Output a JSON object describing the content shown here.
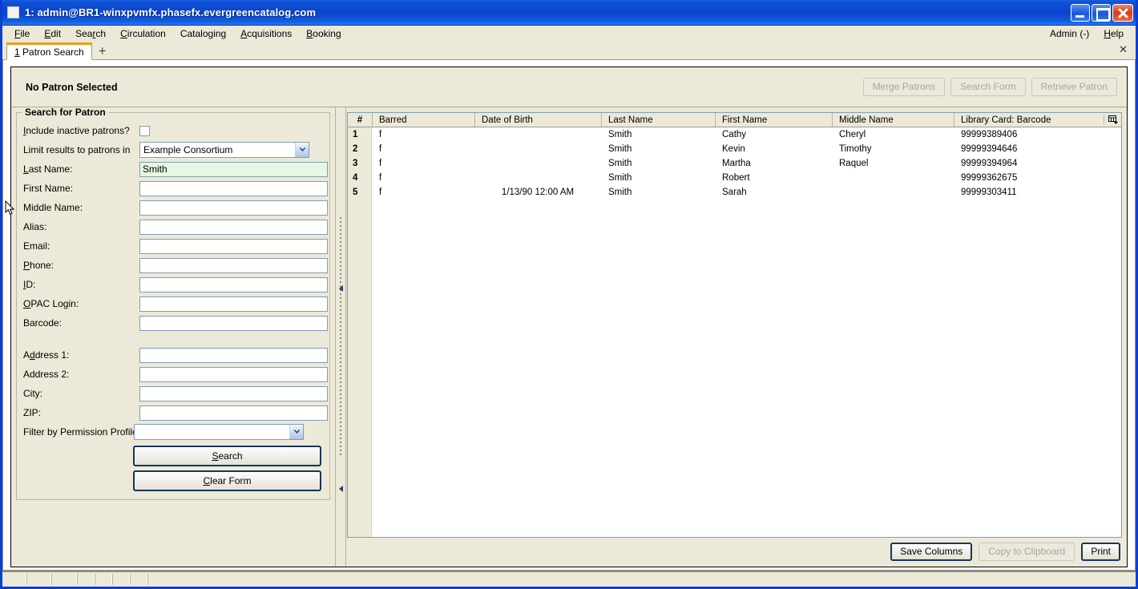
{
  "window": {
    "title": "1: admin@BR1-winxpvmfx.phasefx.evergreencatalog.com",
    "icon": "app-icon",
    "minimize_label": "_",
    "maximize_label": "□",
    "close_label": "✕"
  },
  "menubar": {
    "items": [
      {
        "label": "File",
        "accel": "F"
      },
      {
        "label": "Edit",
        "accel": "E"
      },
      {
        "label": "Search",
        "accel": "r"
      },
      {
        "label": "Circulation",
        "accel": "C"
      },
      {
        "label": "Cataloging",
        "accel": "g"
      },
      {
        "label": "Acquisitions",
        "accel": "A"
      },
      {
        "label": "Booking",
        "accel": "B"
      }
    ],
    "right_items": [
      {
        "label": "Admin (-)",
        "accel": ""
      },
      {
        "label": "Help",
        "accel": "H"
      }
    ]
  },
  "tabstrip": {
    "active_tab": "1 Patron Search",
    "add_tab_label": "+",
    "close_label": "✕"
  },
  "patron_header": {
    "status": "No Patron Selected",
    "buttons": [
      {
        "label": "Merge Patrons",
        "enabled": false,
        "name": "merge-patrons-button"
      },
      {
        "label": "Search Form",
        "enabled": false,
        "name": "search-form-button"
      },
      {
        "label": "Retrieve Patron",
        "enabled": false,
        "name": "retrieve-patron-button"
      }
    ]
  },
  "search_form": {
    "legend": "Search for Patron",
    "include_inactive": {
      "label": "Include inactive patrons?",
      "checked": false
    },
    "limit_results": {
      "label": "Limit results to patrons in",
      "value": "Example Consortium"
    },
    "fields": [
      {
        "label": "Last Name:",
        "value": "Smith",
        "placeholder": "",
        "focused": true,
        "name": "last-name-input"
      },
      {
        "label": "First Name:",
        "value": "",
        "placeholder": "",
        "focused": false,
        "name": "first-name-input"
      },
      {
        "label": "Middle Name:",
        "value": "",
        "placeholder": "",
        "focused": false,
        "name": "middle-name-input"
      },
      {
        "label": "Alias:",
        "value": "",
        "placeholder": "",
        "focused": false,
        "name": "alias-input"
      },
      {
        "label": "Email:",
        "value": "",
        "placeholder": "",
        "focused": false,
        "name": "email-input"
      },
      {
        "label": "Phone:",
        "value": "",
        "placeholder": "",
        "focused": false,
        "name": "phone-input"
      },
      {
        "label": "ID:",
        "value": "",
        "placeholder": "",
        "focused": false,
        "name": "id-input"
      },
      {
        "label": "OPAC Login:",
        "value": "",
        "placeholder": "",
        "focused": false,
        "name": "opac-login-input"
      },
      {
        "label": "Barcode:",
        "value": "",
        "placeholder": "",
        "focused": false,
        "name": "barcode-input"
      }
    ],
    "address_fields": [
      {
        "label": "Address 1:",
        "value": "",
        "placeholder": "",
        "name": "address1-input"
      },
      {
        "label": "Address 2:",
        "value": "",
        "placeholder": "",
        "name": "address2-input"
      },
      {
        "label": "City:",
        "value": "",
        "placeholder": "",
        "name": "city-input"
      },
      {
        "label": "ZIP:",
        "value": "",
        "placeholder": "",
        "name": "zip-input"
      }
    ],
    "permission_profile": {
      "label": "Filter by Permission Profile:",
      "value": ""
    },
    "search_button": "Search",
    "clear_button": "Clear Form"
  },
  "results": {
    "columns": [
      "#",
      "Barred",
      "Date of Birth",
      "Last Name",
      "First Name",
      "Middle Name",
      "Library Card: Barcode"
    ],
    "column_picker_icon": "column-picker-icon",
    "rows": [
      {
        "num": "1",
        "barred": "f",
        "dob": "",
        "last": "Smith",
        "first": "Cathy",
        "middle": "Cheryl",
        "card": "99999389406"
      },
      {
        "num": "2",
        "barred": "f",
        "dob": "",
        "last": "Smith",
        "first": "Kevin",
        "middle": "Timothy",
        "card": "99999394646"
      },
      {
        "num": "3",
        "barred": "f",
        "dob": "",
        "last": "Smith",
        "first": "Martha",
        "middle": "Raquel",
        "card": "99999394964"
      },
      {
        "num": "4",
        "barred": "f",
        "dob": "",
        "last": "Smith",
        "first": "Robert",
        "middle": "",
        "card": "99999362675"
      },
      {
        "num": "5",
        "barred": "f",
        "dob": "1/13/90 12:00 AM",
        "last": "Smith",
        "first": "Sarah",
        "middle": "",
        "card": "99999303411"
      }
    ],
    "footer_buttons": [
      {
        "label": "Save Columns",
        "enabled": true,
        "default": true,
        "name": "save-columns-button"
      },
      {
        "label": "Copy to Clipboard",
        "enabled": false,
        "default": false,
        "name": "copy-to-clipboard-button"
      },
      {
        "label": "Print",
        "enabled": true,
        "default": true,
        "name": "print-button"
      }
    ]
  },
  "colors": {
    "titlebar_blue": "#0b44cd",
    "window_beige": "#ece9d8",
    "tab_accent_orange": "#f59a18",
    "focused_field_green": "#e6f7e1",
    "field_border_blue": "#7f9db9"
  }
}
